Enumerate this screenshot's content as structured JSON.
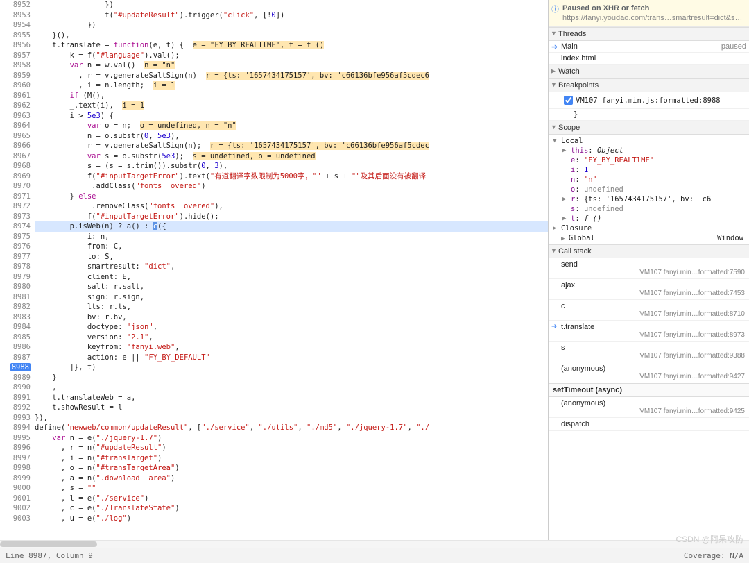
{
  "status": {
    "line_col": "Line 8987, Column 9",
    "coverage": "Coverage: N/A"
  },
  "watermark": "CSDN @阿呆攻防",
  "paused": {
    "title": "Paused on XHR or fetch",
    "url": "https://fanyi.youdao.com/trans…smartresult=dict&smartresult=r…"
  },
  "threads": {
    "header": "Threads",
    "main": {
      "name": "Main",
      "state": "paused"
    },
    "index": "index.html"
  },
  "watch_header": "Watch",
  "breakpoints": {
    "header": "Breakpoints",
    "items": [
      {
        "checked": true,
        "label": "VM107 fanyi.min.js:formatted:8988",
        "snippet": "}"
      }
    ]
  },
  "scope": {
    "header": "Scope",
    "local_label": "Local",
    "closure_label": "Closure",
    "global_label": "Global",
    "global_type": "Window",
    "vars": {
      "this_k": "this",
      "this_v": "Object",
      "e_k": "e",
      "e_v": "\"FY_BY_REALTlME\"",
      "i_k": "i",
      "i_v": "1",
      "n_k": "n",
      "n_v": "\"n\"",
      "o_k": "o",
      "o_v": "undefined",
      "r_k": "r",
      "r_v": "{ts: '1657434175157', bv: 'c6",
      "s_k": "s",
      "s_v": "undefined",
      "t_k": "t",
      "t_v": "f ()"
    }
  },
  "callstack": {
    "header": "Call stack",
    "frames": [
      {
        "name": "send",
        "loc": "VM107 fanyi.min…formatted:7590"
      },
      {
        "name": "ajax",
        "loc": "VM107 fanyi.min…formatted:7453"
      },
      {
        "name": "c",
        "loc": "VM107 fanyi.min…formatted:8710"
      },
      {
        "name": "t.translate",
        "loc": "VM107 fanyi.min…formatted:8973",
        "current": true
      },
      {
        "name": "s",
        "loc": "VM107 fanyi.min…formatted:9388"
      },
      {
        "name": "(anonymous)",
        "loc": "VM107 fanyi.min…formatted:9427"
      }
    ],
    "async_label": "setTimeout (async)",
    "async_frames": [
      {
        "name": "(anonymous)",
        "loc": "VM107 fanyi.min…formatted:9425"
      },
      {
        "name": "dispatch",
        "loc": ""
      }
    ]
  },
  "gutter": {
    "start": 8952,
    "end": 9003,
    "exec_line": 8973,
    "bp_line": 8988
  },
  "code_values": {
    "l8952_indent": "                ",
    "l8952_b": "})",
    "l8953_indent": "                ",
    "l8953_a": "f(",
    "l8953_b": "\"#updateResult\"",
    "l8953_c": ").trigger(",
    "l8953_d": "\"click\"",
    "l8953_e": ", [!",
    "l8953_f": "0",
    "l8953_g": "])",
    "l8954_indent": "            ",
    "l8954_a": "})",
    "l8955": "    }(),",
    "l8956_a_indent": "    ",
    "l8956_a": "t.translate = ",
    "l8956_b": "function",
    "l8956_c": "(e, t) {  ",
    "l8956_d": "e = \"FY_BY_REALTlME\", t = f ()",
    "l8957_indent": "        ",
    "l8957_a": "k = f(",
    "l8957_b": "\"#language\"",
    "l8957_c": ").val();",
    "l8958_indent": "        ",
    "l8958_a": "var",
    "l8958_b": " n = w.val()  ",
    "l8958_c": "n = \"n\"",
    "l8959_indent": "          ",
    "l8959_a": ", r = v.generateSaltSign(n)  ",
    "l8959_b": "r = {ts: '1657434175157', bv: 'c66136bfe956af5cdec6",
    "l8960_indent": "          ",
    "l8960_a": ", i = n.length;  ",
    "l8960_b": "i = 1",
    "l8961_indent": "        ",
    "l8961_a": "if",
    "l8961_b": " (M(),",
    "l8962_indent": "        ",
    "l8962_a": "_.text(i),  ",
    "l8962_b": "i = 1",
    "l8963_indent": "        ",
    "l8963_a": "i > ",
    "l8963_b": "5e3",
    "l8963_c": ") {",
    "l8964_indent": "            ",
    "l8964_a": "var",
    "l8964_b": " o = n;  ",
    "l8964_c": "o = undefined, n = \"n\"",
    "l8965_indent": "            ",
    "l8965_a": "n = o.substr(",
    "l8965_b": "0",
    "l8965_c": ", ",
    "l8965_d": "5e3",
    "l8965_e": "),",
    "l8966_indent": "            ",
    "l8966_a": "r = v.generateSaltSign(n);  ",
    "l8966_b": "r = {ts: '1657434175157', bv: 'c66136bfe956af5cdec",
    "l8967_indent": "            ",
    "l8967_a": "var",
    "l8967_b": " s = o.substr(",
    "l8967_c": "5e3",
    "l8967_d": ");  ",
    "l8967_e": "s = undefined, o = undefined",
    "l8968_indent": "            ",
    "l8968_a": "s = (s = s.trim()).substr(",
    "l8968_b": "0",
    "l8968_c": ", ",
    "l8968_d": "3",
    "l8968_e": "),",
    "l8969_indent": "            ",
    "l8969_a": "f(",
    "l8969_b": "\"#inputTargetError\"",
    "l8969_c": ").text(",
    "l8969_d": "\"有道翻译字数限制为5000字，\"\"",
    "l8969_e": " + s + ",
    "l8969_f": "\"\"及其后面没有被翻译",
    "l8970_indent": "            ",
    "l8970_a": "_.addClass(",
    "l8970_b": "\"fonts__overed\"",
    "l8970_c": ")",
    "l8971_indent": "        ",
    "l8971_a": "} ",
    "l8971_b": "else",
    "l8972_indent": "            ",
    "l8972_a": "_.removeClass(",
    "l8972_b": "\"fonts__overed\"",
    "l8972_c": "),",
    "l8973_indent": "            ",
    "l8973_a": "f(",
    "l8973_b": "\"#inputTargetError\"",
    "l8973_c": ").hide();",
    "l8974_indent": "        ",
    "l8974_a": "p.isWeb(n) ? a() : ",
    "l8974_b": "c",
    "l8974_c": "({",
    "l8975_indent": "            ",
    "l8975_a": "i: n,",
    "l8976_indent": "            ",
    "l8976_a": "from: C,",
    "l8977_indent": "            ",
    "l8977_a": "to: S,",
    "l8978_indent": "            ",
    "l8978_a": "smartresult: ",
    "l8978_b": "\"dict\"",
    "l8978_c": ",",
    "l8979_indent": "            ",
    "l8979_a": "client: E,",
    "l8980_indent": "            ",
    "l8980_a": "salt: r.salt,",
    "l8981_indent": "            ",
    "l8981_a": "sign: r.sign,",
    "l8982_indent": "            ",
    "l8982_a": "lts: r.ts,",
    "l8983_indent": "            ",
    "l8983_a": "bv: r.bv,",
    "l8984_indent": "            ",
    "l8984_a": "doctype: ",
    "l8984_b": "\"json\"",
    "l8984_c": ",",
    "l8985_indent": "            ",
    "l8985_a": "version: ",
    "l8985_b": "\"2.1\"",
    "l8985_c": ",",
    "l8986_indent": "            ",
    "l8986_a": "keyfrom: ",
    "l8986_b": "\"fanyi.web\"",
    "l8986_c": ",",
    "l8987_indent": "            ",
    "l8987_a": "action: e || ",
    "l8987_b": "\"FY_BY_DEFAULT\"",
    "l8988_indent": "        ",
    "l8988_a": "|}, t)",
    "l8989_indent": "    ",
    "l8989_a": "}",
    "l8990_indent": "    ",
    "l8990_a": ",",
    "l8991_indent": "    ",
    "l8991_a": "t.translateWeb = a,",
    "l8992_indent": "    ",
    "l8992_a": "t.showResult = l",
    "l8993": "}),",
    "l8994_a": "define(",
    "l8994_b": "\"newweb/common/updateResult\"",
    "l8994_c": ", [",
    "l8994_d": "\"./service\"",
    "l8994_e": ", ",
    "l8994_f": "\"./utils\"",
    "l8994_g": ", ",
    "l8994_h": "\"./md5\"",
    "l8994_i": ", ",
    "l8994_j": "\"./jquery-1.7\"",
    "l8994_k": ", ",
    "l8994_l": "\"./",
    "l8995_indent": "    ",
    "l8995_a": "var",
    "l8995_b": " n = e(",
    "l8995_c": "\"./jquery-1.7\"",
    "l8995_d": ")",
    "l8996_indent": "      ",
    "l8996_a": ", r = n(",
    "l8996_b": "\"#updateResult\"",
    "l8996_c": ")",
    "l8997_indent": "      ",
    "l8997_a": ", i = n(",
    "l8997_b": "\"#transTarget\"",
    "l8997_c": ")",
    "l8998_indent": "      ",
    "l8998_a": ", o = n(",
    "l8998_b": "\"#transTargetArea\"",
    "l8998_c": ")",
    "l8999_indent": "      ",
    "l8999_a": ", a = n(",
    "l8999_b": "\".download__area\"",
    "l8999_c": ")",
    "l9000_indent": "      ",
    "l9000_a": ", s = ",
    "l9000_b": "\"\"",
    "l9001_indent": "      ",
    "l9001_a": ", l = e(",
    "l9001_b": "\"./service\"",
    "l9001_c": ")",
    "l9002_indent": "      ",
    "l9002_a": ", c = e(",
    "l9002_b": "\"./TranslateState\"",
    "l9002_c": ")",
    "l9003_indent": "      ",
    "l9003_a": ", u = e(",
    "l9003_b": "\"./log\"",
    "l9003_c": ")"
  }
}
